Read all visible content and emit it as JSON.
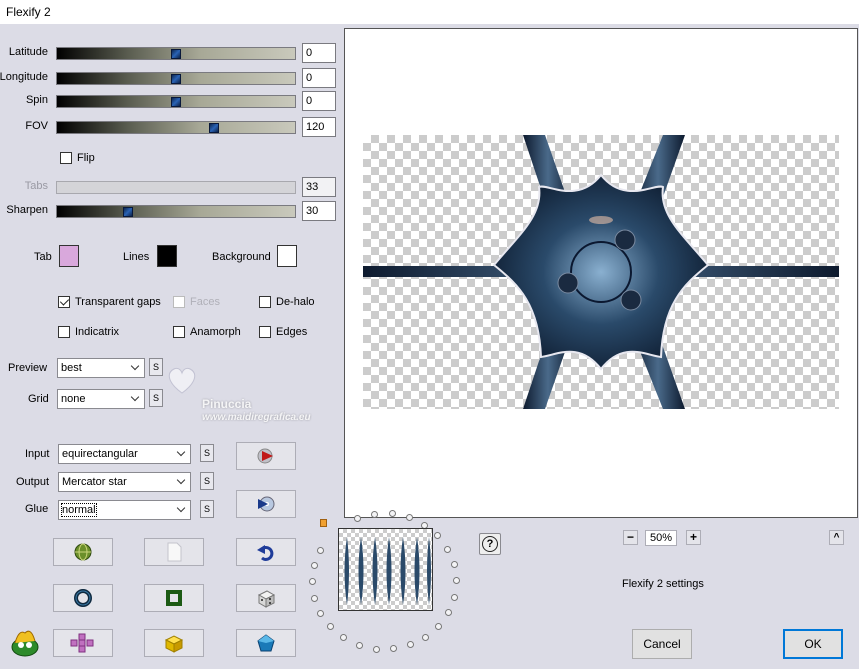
{
  "window": {
    "title": "Flexify 2"
  },
  "sliders": [
    {
      "label": "Latitude",
      "value": "0",
      "thumb_fraction": 0.5,
      "enabled": true
    },
    {
      "label": "Longitude",
      "value": "0",
      "thumb_fraction": 0.5,
      "enabled": true
    },
    {
      "label": "Spin",
      "value": "0",
      "thumb_fraction": 0.5,
      "enabled": true
    },
    {
      "label": "FOV",
      "value": "120",
      "thumb_fraction": 0.66,
      "enabled": true
    },
    {
      "label": "Tabs",
      "value": "33",
      "thumb_fraction": 0,
      "enabled": false
    },
    {
      "label": "Sharpen",
      "value": "30",
      "thumb_fraction": 0.3,
      "enabled": true
    }
  ],
  "checkboxes": {
    "flip": {
      "label": "Flip",
      "checked": false,
      "enabled": true
    },
    "transparent_gaps": {
      "label": "Transparent gaps",
      "checked": true,
      "enabled": true
    },
    "faces": {
      "label": "Faces",
      "checked": false,
      "enabled": false
    },
    "de_halo": {
      "label": "De-halo",
      "checked": false,
      "enabled": true
    },
    "indicatrix": {
      "label": "Indicatrix",
      "checked": false,
      "enabled": true
    },
    "anamorph": {
      "label": "Anamorph",
      "checked": false,
      "enabled": true
    },
    "edges": {
      "label": "Edges",
      "checked": false,
      "enabled": true
    }
  },
  "colors": {
    "tab": {
      "label": "Tab",
      "value": "#d9a8dc"
    },
    "lines": {
      "label": "Lines",
      "value": "#000000"
    },
    "background": {
      "label": "Background",
      "value": "#ffffff"
    }
  },
  "dropdowns": {
    "preview": {
      "label": "Preview",
      "value": "best",
      "s_label": "S"
    },
    "grid": {
      "label": "Grid",
      "value": "none",
      "s_label": "S"
    },
    "input": {
      "label": "Input",
      "value": "equirectangular",
      "s_label": "S"
    },
    "output": {
      "label": "Output",
      "value": "Mercator star",
      "s_label": "S"
    },
    "glue": {
      "label": "Glue",
      "value": "normal",
      "s_label": "S"
    }
  },
  "zoom": {
    "minus": "−",
    "value": "50%",
    "plus": "+",
    "collapse": "^"
  },
  "help": {
    "label": "?"
  },
  "settings_label": "Flexify 2 settings",
  "dialog_buttons": {
    "cancel": "Cancel",
    "ok": "OK"
  },
  "watermark": {
    "name": "Pinuccia",
    "url": "www.maidiregrafica.eu"
  },
  "icons": {
    "input_arrow_button": "red-arrow-icon",
    "output_arrow_button": "disc-arrow-icon",
    "row1": [
      "globe-icon",
      "blank-page-icon",
      "undo-icon"
    ],
    "row2": [
      "ring-icon",
      "frame-icon",
      "dice-icon"
    ],
    "row3": [
      "plugin-logo-icon",
      "cube-net-icon",
      "cube-icon",
      "pentagon-icon"
    ]
  }
}
